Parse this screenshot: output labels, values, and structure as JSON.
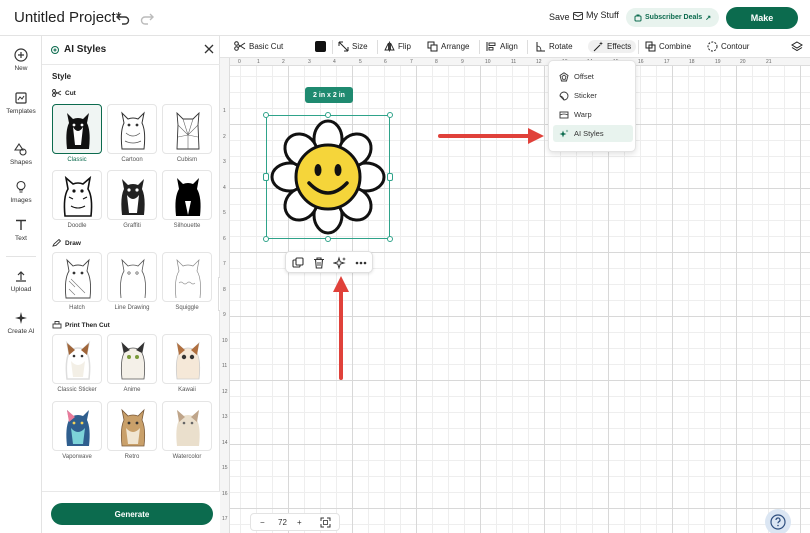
{
  "header": {
    "title": "Untitled Project*",
    "save_label": "Save",
    "mystuff_label": "My Stuff",
    "deals_label": "Subscriber Deals",
    "make_label": "Make"
  },
  "leftnav": {
    "items": [
      {
        "label": "New",
        "icon": "plus-circle-icon"
      },
      {
        "label": "Templates",
        "icon": "templates-icon"
      },
      {
        "label": "Shapes",
        "icon": "shapes-icon"
      },
      {
        "label": "Images",
        "icon": "bulb-icon"
      },
      {
        "label": "Text",
        "icon": "text-icon"
      },
      {
        "label": "Upload",
        "icon": "upload-icon"
      },
      {
        "label": "Create AI",
        "icon": "sparkle-icon"
      }
    ]
  },
  "panel": {
    "title": "AI Styles",
    "style_heading": "Style",
    "groups": [
      {
        "name": "Cut",
        "items": [
          "Classic",
          "Cartoon",
          "Cubism",
          "Doodle",
          "Graffiti",
          "Silhouette"
        ]
      },
      {
        "name": "Draw",
        "items": [
          "Hatch",
          "Line Drawing",
          "Squiggle"
        ]
      },
      {
        "name": "Print Then Cut",
        "items": [
          "Classic Sticker",
          "Anime",
          "Kawaii",
          "Vaporwave",
          "Retro",
          "Watercolor"
        ]
      }
    ],
    "selected": "Classic",
    "generate_label": "Generate"
  },
  "toolbar": {
    "basic_cut": "Basic Cut",
    "size": "Size",
    "flip": "Flip",
    "arrange": "Arrange",
    "align": "Align",
    "rotate": "Rotate",
    "effects": "Effects",
    "combine": "Combine",
    "contour": "Contour"
  },
  "canvas": {
    "size_tag": "2 in x 2 in",
    "ruler_top": [
      "0",
      "1",
      "2",
      "3",
      "4",
      "5",
      "6",
      "7",
      "8",
      "9",
      "10",
      "11",
      "12",
      "13",
      "14",
      "15",
      "16",
      "17",
      "18",
      "19",
      "20",
      "21"
    ],
    "ruler_left": [
      "1",
      "2",
      "3",
      "4",
      "5",
      "6",
      "7",
      "8",
      "9",
      "10",
      "11",
      "12",
      "13",
      "14",
      "15",
      "16",
      "17"
    ]
  },
  "effects_menu": {
    "items": [
      "Offset",
      "Sticker",
      "Warp",
      "AI Styles"
    ],
    "active": "AI Styles"
  },
  "zoom": {
    "minus": "−",
    "value": "72",
    "plus": "+"
  },
  "colors": {
    "brand": "#0c6b4e",
    "accent": "#1f8a70",
    "arrow": "#e0413a",
    "flower_yellow": "#f5d53a"
  }
}
